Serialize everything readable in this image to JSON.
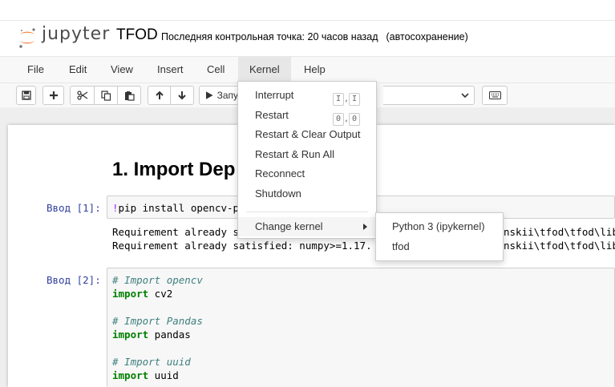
{
  "header": {
    "logo_text": "jupyter",
    "notebook_title": "TFOD",
    "checkpoint": "Последняя контрольная точка: 20 часов назад",
    "autosave": "(автосохранение)"
  },
  "menubar": {
    "items": [
      "File",
      "Edit",
      "View",
      "Insert",
      "Cell",
      "Kernel",
      "Help"
    ],
    "open": "Kernel"
  },
  "toolbar": {
    "run_label": "Запу",
    "buttons": [
      "save-icon",
      "plus-icon",
      "cut-icon",
      "copy-icon",
      "paste-icon",
      "arrow-up-icon",
      "arrow-down-icon",
      "play-icon",
      "keyboard-icon"
    ]
  },
  "kernel_menu": {
    "items": [
      {
        "label": "Interrupt",
        "shortcut": [
          "I",
          "I"
        ]
      },
      {
        "label": "Restart",
        "shortcut": [
          "0",
          "0"
        ]
      },
      {
        "label": "Restart & Clear Output"
      },
      {
        "label": "Restart & Run All"
      },
      {
        "label": "Reconnect"
      },
      {
        "label": "Shutdown"
      }
    ],
    "change_kernel": "Change kernel",
    "submenu": [
      "Python 3 (ipykernel)",
      "tfod"
    ]
  },
  "cells": {
    "heading_visible": "1. Import Dep",
    "cell1": {
      "prompt": "Ввод [1]:",
      "code_bang": "!",
      "code_visible": "pip install opencv-p",
      "output_line1_left": "Requirement already s",
      "output_line1_right": "nskii\\tfod\\tfod\\lib",
      "output_line2_left": "Requirement already satisfied: numpy>=1.17.",
      "output_line2_right": "nskii\\tfod\\tfod\\lib"
    },
    "cell2": {
      "prompt": "Ввод [2]:",
      "comment1": "# Import opencv",
      "kw1": "import",
      "mod1": " cv2",
      "comment2": "# Import Pandas",
      "kw2": "import",
      "mod2": " pandas",
      "comment3": "# Import uuid",
      "kw3": "import",
      "mod3": " uuid"
    }
  },
  "colors": {
    "logo_orange": "#f37626",
    "prompt_blue": "#303f9f",
    "keyword_green": "#008000",
    "comment_teal": "#408080"
  }
}
